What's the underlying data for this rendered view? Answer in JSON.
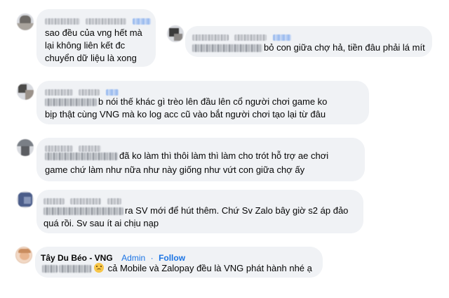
{
  "comments": [
    {
      "lines": [
        "sao đều của vng hết mà",
        "lại không liên kết đc",
        "chuyển dữ liệu là xong"
      ]
    },
    {
      "lines": [
        "bỏ con giữa chợ hả, tiền đâu phải lá mít"
      ]
    },
    {
      "lines": [
        "b nói thế khác gì trèo lên đầu lên cổ người chơi game ko",
        "bịp thật cùng VNG mà ko log acc cũ vào bắt người chơi tạo lại từ đâu"
      ]
    },
    {
      "lines": [
        "đã ko làm thì thôi làm thì làm cho trót hỗ trợ ae chơi",
        "game chứ làm như nữa như này giống như vứt con giữa chợ ấy"
      ]
    },
    {
      "lines": [
        "ra SV mới để hút thêm. Chứ Sv Zalo bây giờ s2 áp đảo",
        "quá rồi. Sv sau ít ai chịu nạp"
      ]
    },
    {
      "author": "Tây Du Béo - VNG",
      "role": "Admin",
      "separator": "·",
      "follow": "Follow",
      "emoji": "frowning-face-icon",
      "text": "cả Mobile và Zalopay đều là VNG phát hành nhé ạ"
    }
  ],
  "colors": {
    "bubble": "#f0f2f5",
    "link": "#1b74e4",
    "text": "#050505"
  }
}
